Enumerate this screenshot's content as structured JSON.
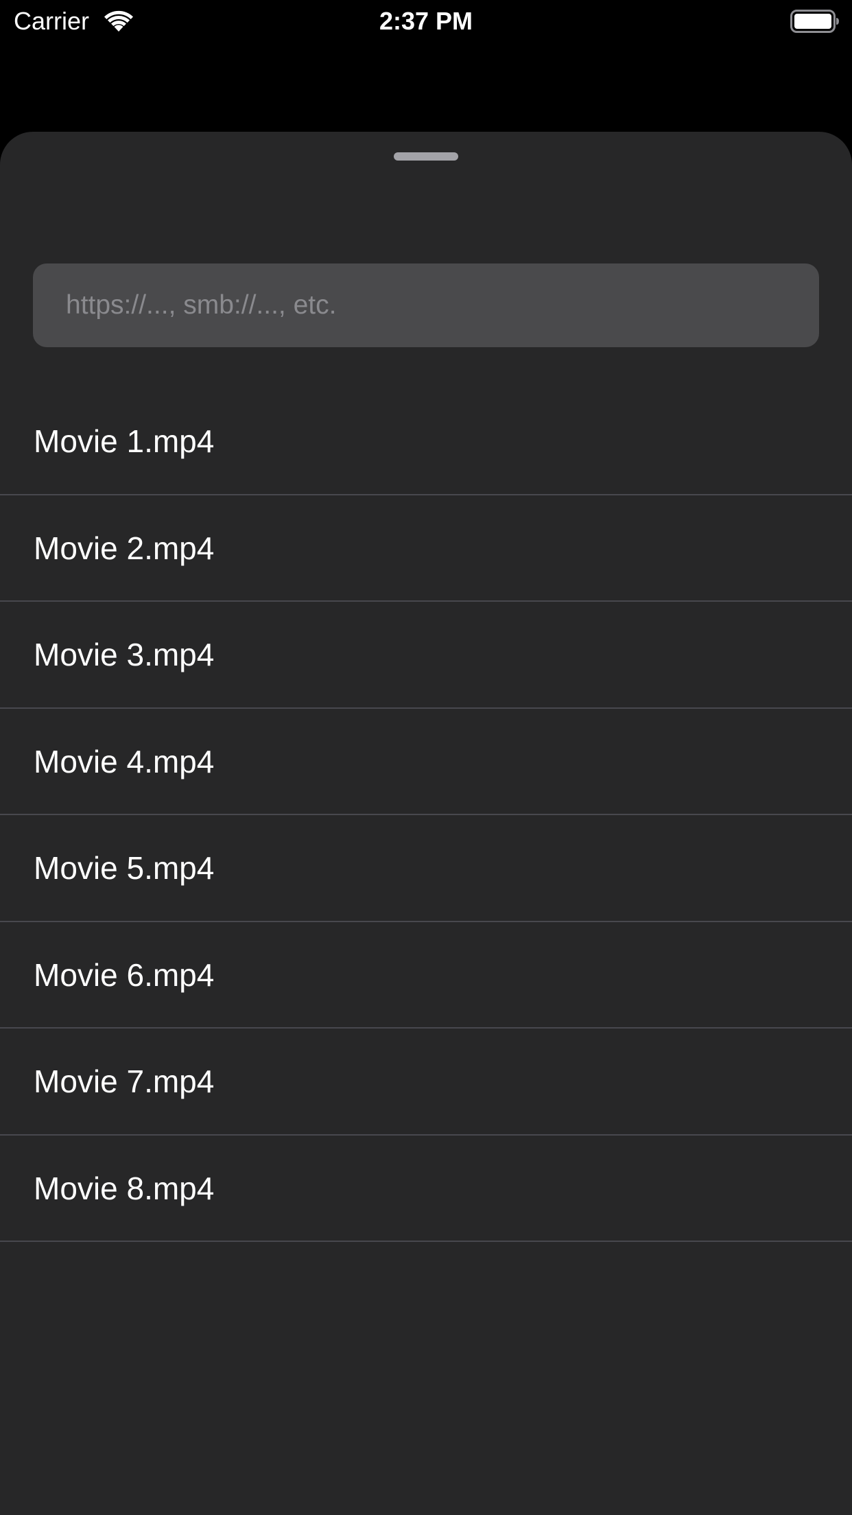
{
  "status_bar": {
    "carrier": "Carrier",
    "time": "2:37 PM",
    "icons": [
      "wifi-icon",
      "battery-icon"
    ]
  },
  "sheet": {
    "grabber_icon": "grabber-handle",
    "url_input": {
      "placeholder": "https://..., smb://..., etc.",
      "value": ""
    },
    "files": [
      {
        "name": "Movie 1.mp4"
      },
      {
        "name": "Movie 2.mp4"
      },
      {
        "name": "Movie 3.mp4"
      },
      {
        "name": "Movie 4.mp4"
      },
      {
        "name": "Movie 5.mp4"
      },
      {
        "name": "Movie 6.mp4"
      },
      {
        "name": "Movie 7.mp4"
      },
      {
        "name": "Movie 8.mp4"
      }
    ]
  },
  "colors": {
    "background": "#000000",
    "sheet": "#272728",
    "input": "#4a4a4c",
    "separator": "#48484e",
    "text": "#ffffff",
    "placeholder": "#8a8a8e"
  }
}
